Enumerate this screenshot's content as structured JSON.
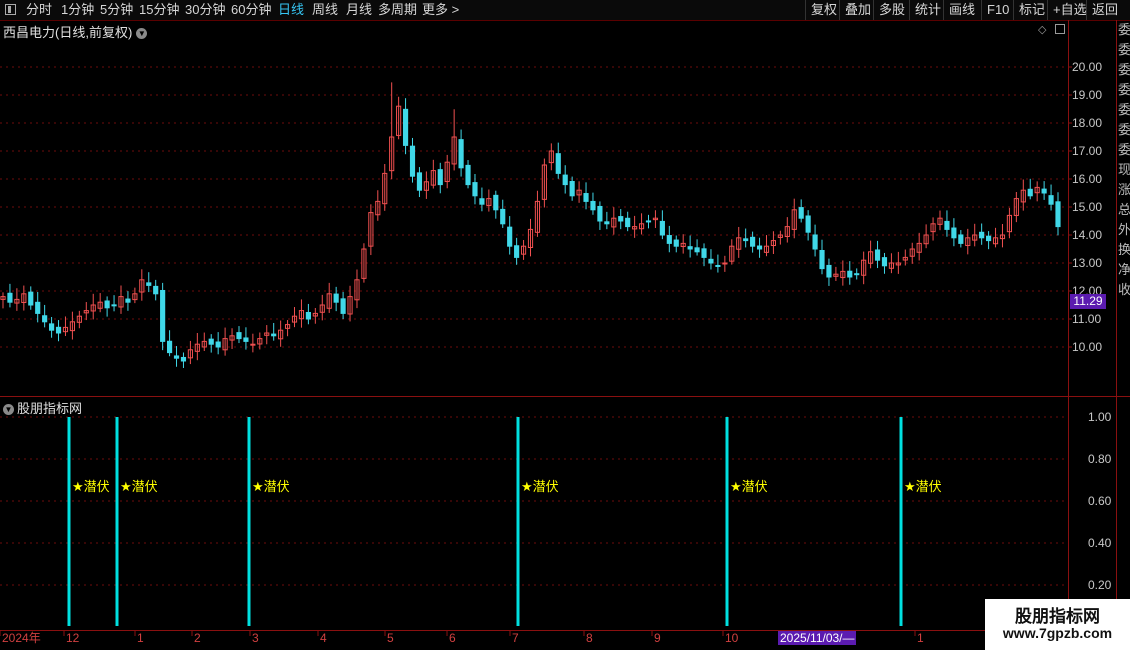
{
  "toolbar": {
    "periods": [
      "分时",
      "1分钟",
      "5分钟",
      "15分钟",
      "30分钟",
      "60分钟",
      "日线",
      "周线",
      "月线",
      "多周期",
      "更多 >"
    ],
    "active": "日线",
    "actions": [
      "复权",
      "叠加",
      "多股",
      "统计",
      "画线",
      "F10",
      "标记",
      "+自选",
      "返回"
    ]
  },
  "main_panel": {
    "title": "西昌电力(日线,前复权)",
    "last_price": "11.29"
  },
  "indicator_panel": {
    "title": "股朋指标网",
    "signal_label": "★潜伏"
  },
  "bottom_axis": {
    "labels": [
      "2024年",
      "12",
      "1",
      "2",
      "3",
      "4",
      "5",
      "6",
      "7",
      "8",
      "9",
      "10",
      "1"
    ],
    "crosshair_date": "2025/11/03/—"
  },
  "watermark": {
    "line1": "股朋指标网",
    "line2": "www.7gpzb.com"
  },
  "right_column_chars": "委委委委委委委现涨总外换净收",
  "colors": {
    "up": "#f05050",
    "down": "#40d8e8",
    "grid": "#6e0b0b",
    "signal": "#00e0e0",
    "label": "#ffff00",
    "price_tag": "#5b1bb0"
  },
  "chart_data": [
    {
      "type": "candlestick",
      "title": "西昌电力(日线,前复权)",
      "ylim": [
        9,
        21
      ],
      "y_ticks": [
        10,
        11,
        12,
        13,
        14,
        15,
        16,
        17,
        18,
        19,
        20
      ],
      "y_tick_labels": [
        "10.00",
        "11.00",
        "12.00",
        "13.00",
        "14.00",
        "15.00",
        "16.00",
        "17.00",
        "18.00",
        "19.00",
        "20.00"
      ],
      "x_tick_labels": [
        "2024年",
        "12",
        "1",
        "2",
        "3",
        "4",
        "5",
        "6",
        "7",
        "8",
        "9",
        "10",
        "1"
      ],
      "close_path_approx": [
        11.8,
        11.6,
        11.7,
        11.9,
        11.5,
        11.2,
        10.9,
        10.6,
        10.5,
        10.7,
        10.9,
        11.1,
        11.3,
        11.5,
        11.6,
        11.4,
        11.5,
        11.8,
        11.6,
        11.9,
        12.4,
        12.2,
        11.9,
        10.2,
        9.8,
        9.6,
        9.5,
        9.9,
        10.1,
        10.2,
        10.1,
        10.0,
        10.3,
        10.4,
        10.3,
        10.2,
        10.1,
        10.3,
        10.5,
        10.4,
        10.6,
        10.8,
        11.1,
        11.3,
        11.0,
        11.2,
        11.5,
        11.9,
        11.6,
        11.2,
        11.8,
        12.4,
        13.5,
        14.8,
        15.2,
        16.2,
        17.5,
        18.6,
        17.2,
        16.1,
        15.6,
        15.9,
        16.3,
        15.8,
        16.6,
        17.5,
        16.4,
        15.8,
        15.4,
        15.1,
        15.3,
        14.9,
        14.4,
        13.6,
        13.2,
        13.6,
        14.2,
        15.2,
        16.5,
        17.0,
        16.2,
        15.8,
        15.4,
        15.6,
        15.2,
        14.9,
        14.5,
        14.4,
        14.6,
        14.5,
        14.3,
        14.3,
        14.4,
        14.5,
        14.6,
        14.0,
        13.7,
        13.6,
        13.7,
        13.5,
        13.4,
        13.2,
        13.0,
        12.9,
        13.0,
        13.6,
        13.9,
        13.8,
        13.6,
        13.5,
        13.6,
        13.8,
        14.0,
        14.3,
        14.9,
        14.6,
        14.1,
        13.5,
        12.8,
        12.5,
        12.6,
        12.7,
        12.5,
        12.6,
        13.1,
        13.4,
        13.1,
        12.9,
        13.0,
        13.0,
        13.2,
        13.5,
        13.7,
        14.0,
        14.4,
        14.6,
        14.2,
        13.9,
        13.7,
        13.9,
        14.0,
        13.9,
        13.8,
        13.9,
        14.0,
        14.7,
        15.3,
        15.6,
        15.4,
        15.7,
        15.5,
        15.1,
        14.3
      ]
    },
    {
      "type": "bar",
      "title": "股朋指标网",
      "ylim": [
        0,
        1.1
      ],
      "y_tick_labels": [
        "1.00",
        "0.80",
        "0.60",
        "0.40",
        "0.20"
      ],
      "signal_value": 1.0,
      "signal_series": "★潜伏",
      "signal_count": 6
    }
  ]
}
